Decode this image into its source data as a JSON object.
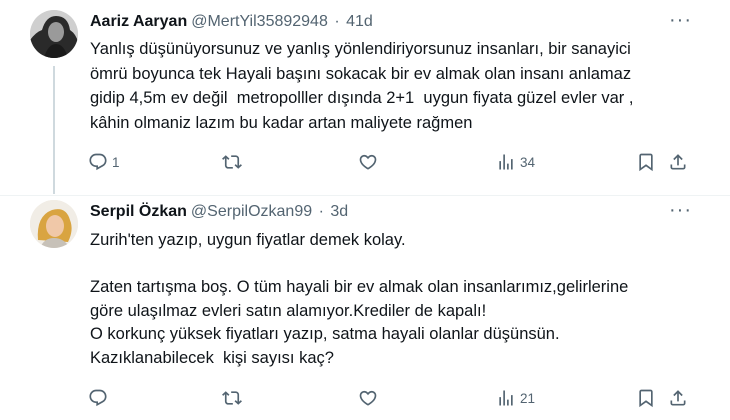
{
  "tweets": [
    {
      "name": "Aariz Aaryan",
      "handle": "@MertYil35892948",
      "separator": "·",
      "time": "41d",
      "more_label": "···",
      "text_lines": [
        "Yanlış düşünüyorsunuz ve yanlış yönlendiriyorsunuz insanları, bir sanayici",
        "ömrü boyunca tek Hayali başını sokacak bir ev almak olan insanı anlamaz",
        "gidip 4,5m ev değil  metropolller dışında 2+1  uygun fiyata güzel evler var ,",
        "kâhin olmaniz lazım bu kadar artan maliyete rağmen"
      ],
      "actions": {
        "reply_count": "1",
        "retweet_count": "",
        "like_count": "",
        "views_count": "34"
      }
    },
    {
      "name": "Serpil Özkan",
      "handle": "@SerpilOzkan99",
      "separator": "·",
      "time": "3d",
      "more_label": "···",
      "text_lines": [
        "Zurih'ten yazıp, uygun fiyatlar demek kolay.",
        "",
        "Zaten tartışma boş. O tüm hayali bir ev almak olan insanlarımız,gelirlerine",
        "göre ulaşılmaz evleri satın alamıyor.Krediler de kapalı!",
        "O korkunç yüksek fiyatları yazıp, satma hayali olanlar düşünsün.",
        "Kazıklanabilecek  kişi sayısı kaç?"
      ],
      "actions": {
        "reply_count": "",
        "retweet_count": "",
        "like_count": "",
        "views_count": "21"
      }
    }
  ],
  "icons": {
    "reply": "reply-icon",
    "retweet": "retweet-icon",
    "like": "heart-icon",
    "views": "analytics-icon",
    "bookmark": "bookmark-icon",
    "share": "share-icon",
    "more": "more-dots-icon"
  },
  "colors": {
    "text_primary": "#0f1419",
    "text_secondary": "#536471",
    "thread_line": "#cfd9de",
    "divider": "#eff3f4"
  }
}
